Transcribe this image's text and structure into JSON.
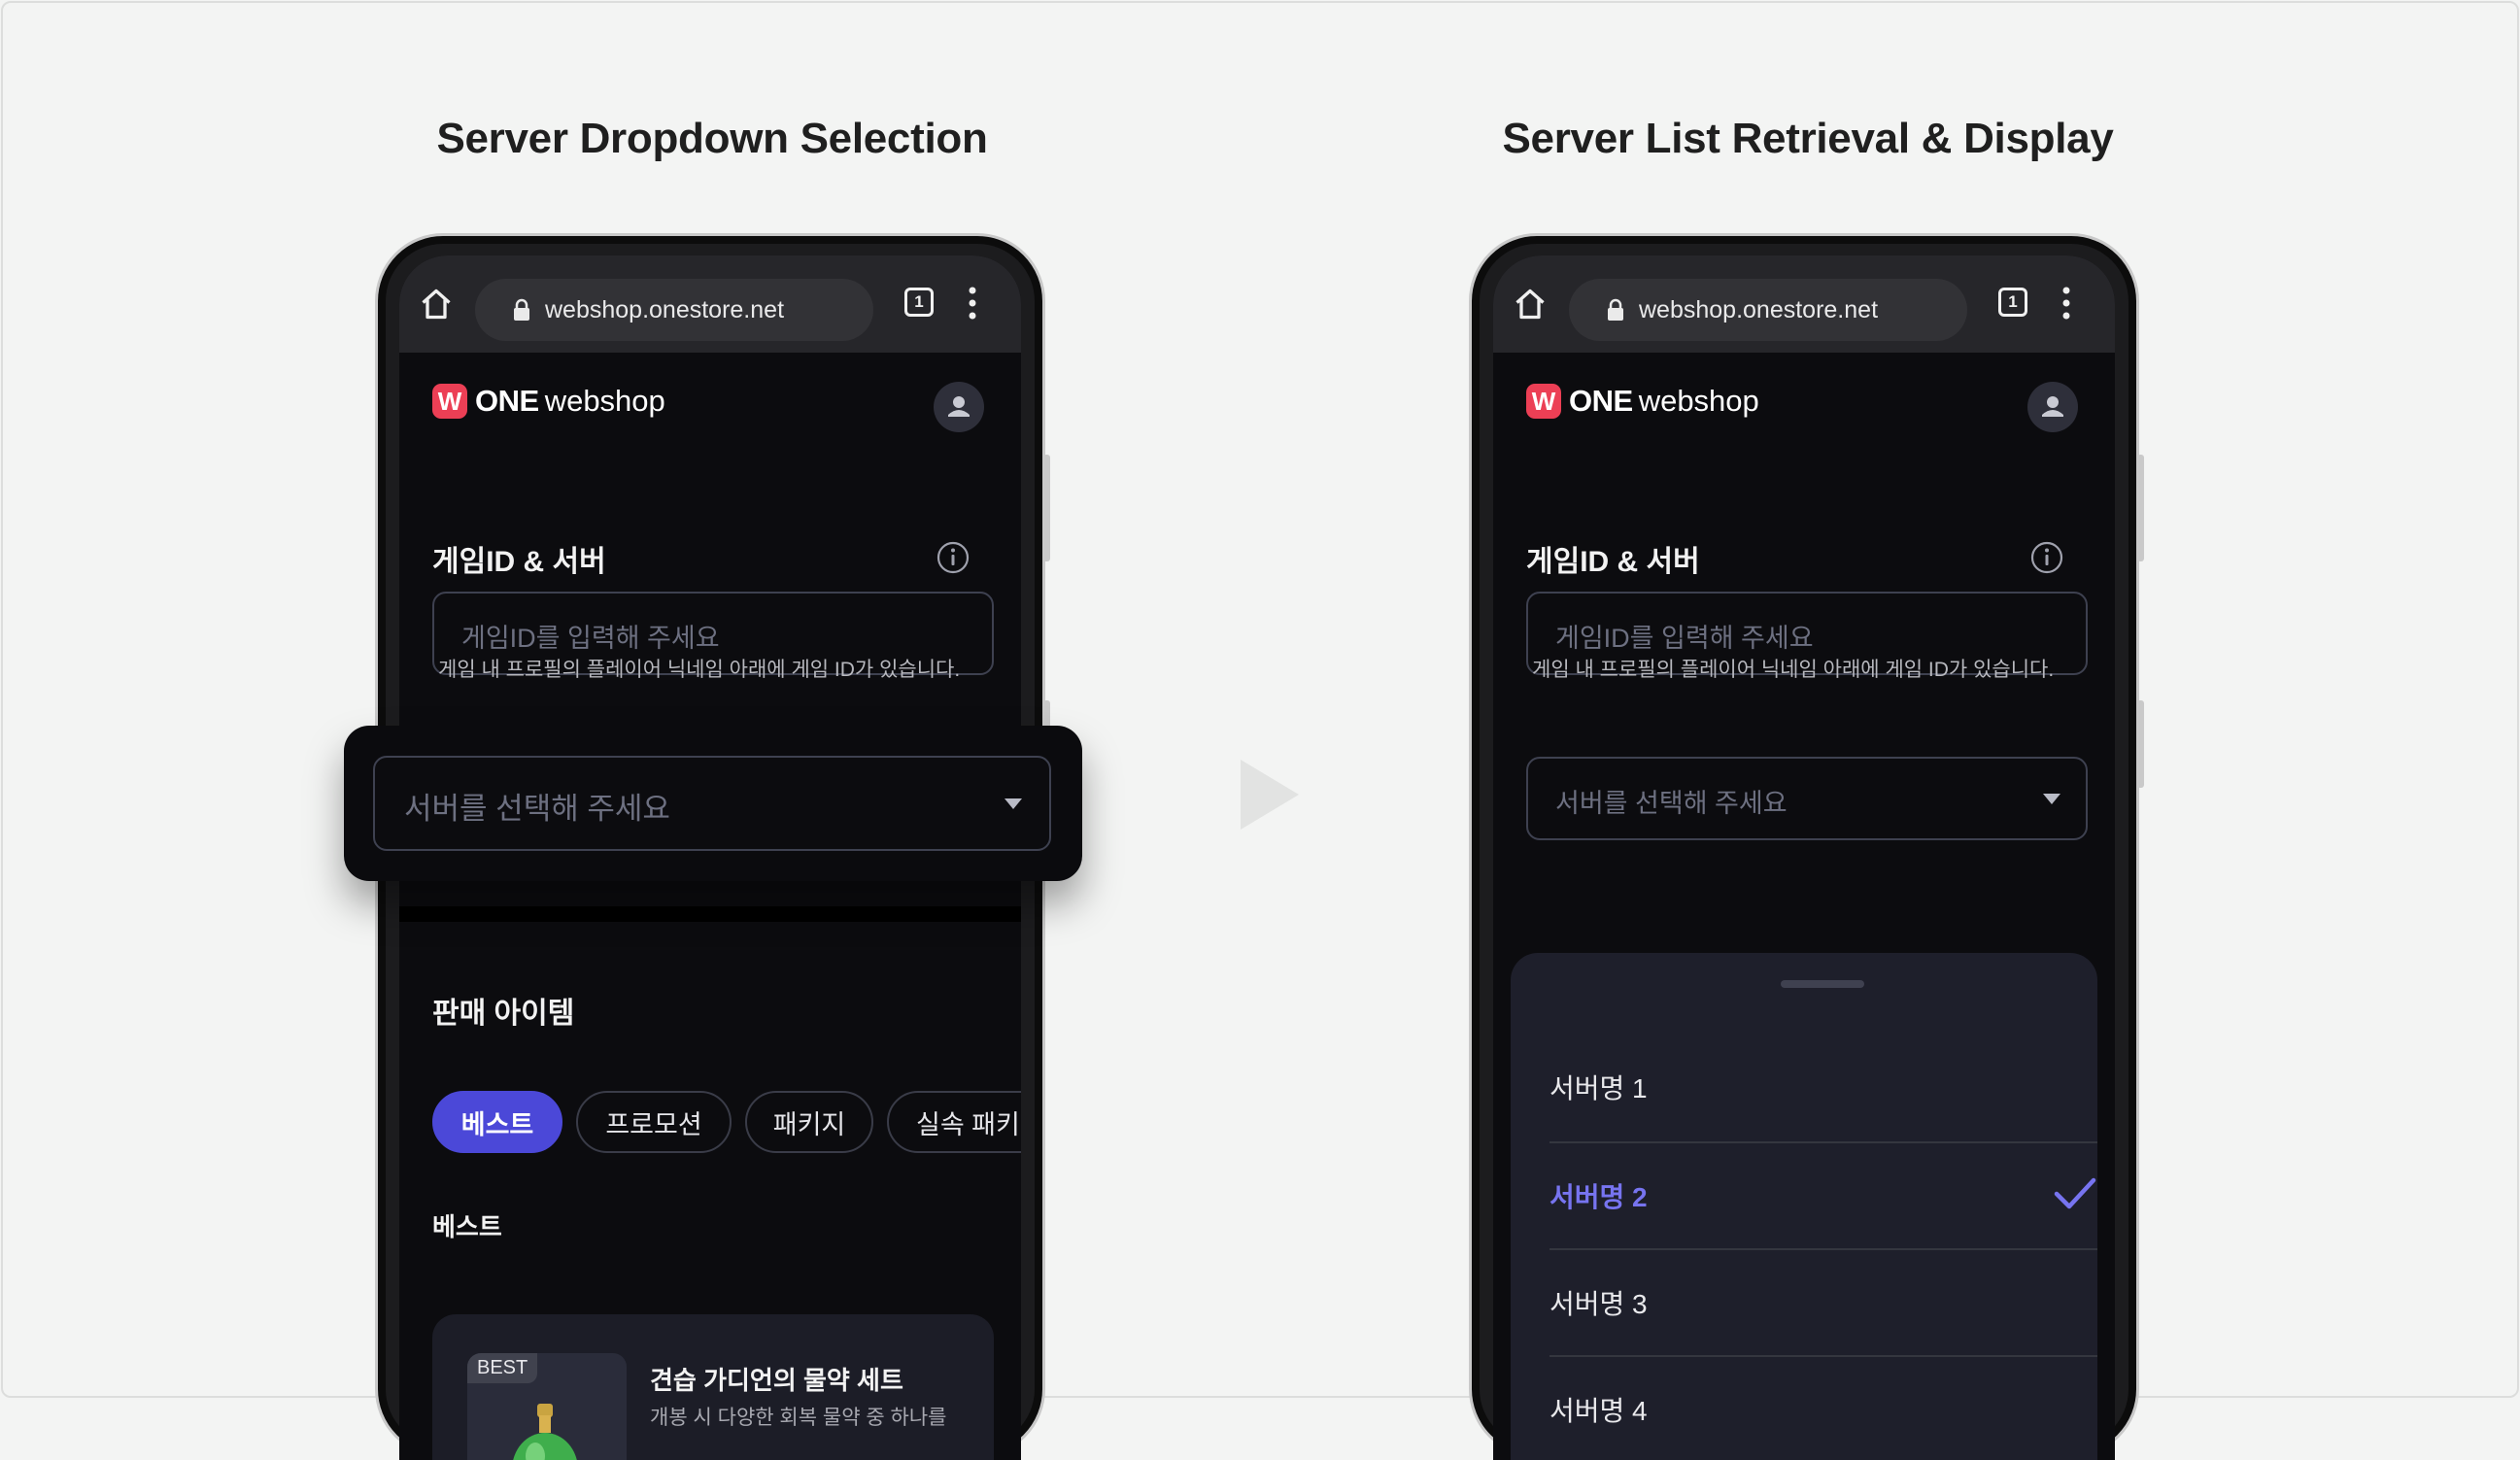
{
  "panels": {
    "left_title": "Server Dropdown Selection",
    "right_title": "Server List Retrieval & Display"
  },
  "browser": {
    "url": "webshop.onestore.net",
    "tab_count": "1"
  },
  "brand": {
    "logo_letter": "W",
    "one": "ONE",
    "web": "webshop"
  },
  "game_section": {
    "title": "게임ID & 서버",
    "id_placeholder": "게임ID를 입력해 주세요",
    "help_text": "게임 내 프로필의 플레이어 닉네임 아래에 게임 ID가 있습니다.",
    "server_placeholder": "서버를 선택해 주세요"
  },
  "sale_section": {
    "title": "판매 아이템",
    "chips": [
      "베스트",
      "프로모션",
      "패키지",
      "실속 패키지"
    ],
    "subtitle": "베스트",
    "card": {
      "badge": "BEST",
      "title": "견습 가디언의 물약 세트",
      "desc": "개봉 시 다양한 회복 물약 중 하나를"
    }
  },
  "server_list": {
    "items": [
      "서버명 1",
      "서버명 2",
      "서버명 3",
      "서버명 4"
    ],
    "selected": "서버명 2"
  },
  "colors": {
    "accent": "#4b48d8",
    "selected_text": "#7774f0",
    "brand_red": "#ec3f55"
  }
}
